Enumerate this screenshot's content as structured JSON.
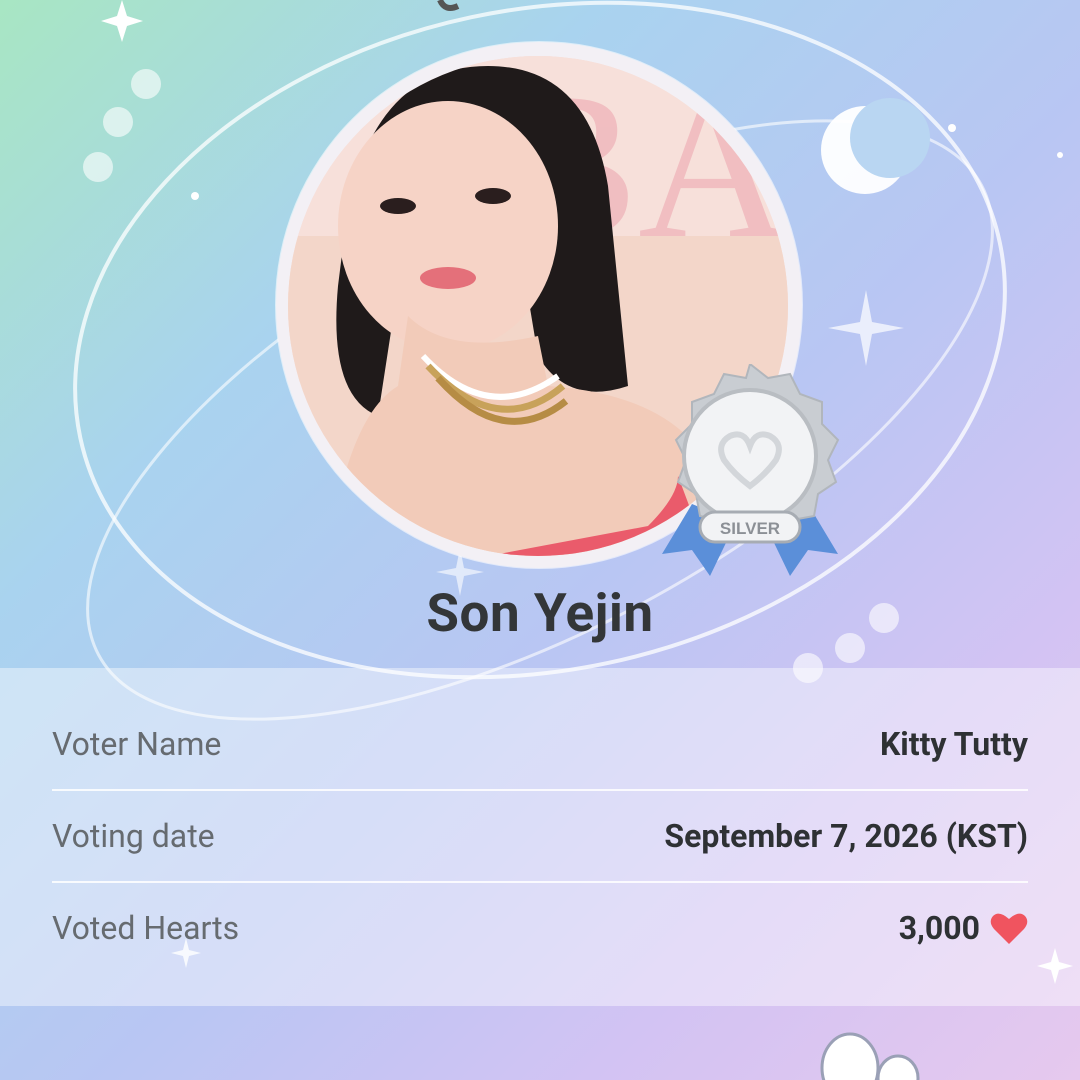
{
  "certificate": {
    "idol_name": "Son Yejin",
    "badge_label": "SILVER"
  },
  "details": {
    "rows": [
      {
        "label": "Voter Name",
        "value": "Kitty Tutty"
      },
      {
        "label": "Voting date",
        "value": "September 7, 2026 (KST)"
      },
      {
        "label": "Voted Hearts",
        "value": "3,000"
      }
    ],
    "heart_icon": "heart-icon"
  },
  "colors": {
    "heart": "#f0545f",
    "badge_ribbon": "#5b8fd9",
    "badge_silver": "#c9cdd2"
  }
}
